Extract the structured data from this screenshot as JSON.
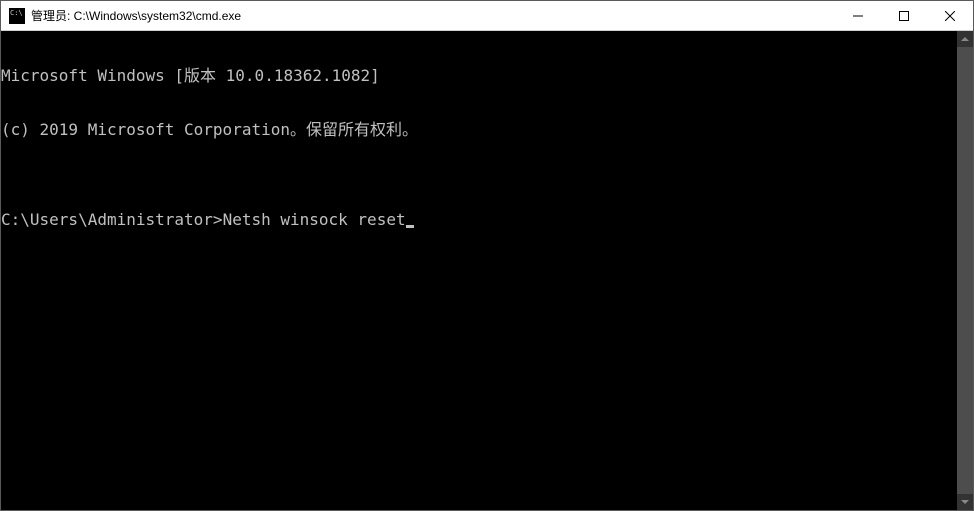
{
  "titlebar": {
    "title": "管理员: C:\\Windows\\system32\\cmd.exe"
  },
  "terminal": {
    "line1": "Microsoft Windows [版本 10.0.18362.1082]",
    "line2": "(c) 2019 Microsoft Corporation。保留所有权利。",
    "blank": "",
    "prompt": "C:\\Users\\Administrator>",
    "command": "Netsh winsock reset"
  }
}
